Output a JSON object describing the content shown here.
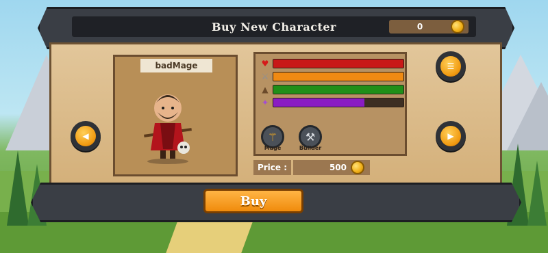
{
  "header": {
    "title": "Buy New Character",
    "coins": "0",
    "coin_icon": "gold-coin-icon"
  },
  "character": {
    "name": "badMage",
    "portrait_icon": "mage-hero-icon"
  },
  "stats": [
    {
      "icon": "heart-icon",
      "color": "#c81818",
      "fill_fraction": 1.0
    },
    {
      "icon": "sword-icon",
      "color": "#f08a12",
      "fill_fraction": 1.0
    },
    {
      "icon": "boot-icon",
      "color": "#1f8f18",
      "fill_fraction": 1.0
    },
    {
      "icon": "magic-icon",
      "color": "#8a1cc2",
      "fill_fraction": 0.7
    }
  ],
  "skills": [
    {
      "label": "Mage",
      "icon": "fire-staff-icon"
    },
    {
      "label": "Builder",
      "icon": "hammer-icon"
    }
  ],
  "price": {
    "label": "Price :",
    "value": "500",
    "coin_icon": "gold-coin-icon"
  },
  "buttons": {
    "buy_label": "Buy",
    "prev_icon": "left-arrow-icon",
    "next_icon": "right-arrow-icon",
    "info_icon": "info-icon"
  },
  "colors": {
    "accent": "#f19b12",
    "panel": "#d4b07a",
    "frame": "#3a3e45"
  }
}
